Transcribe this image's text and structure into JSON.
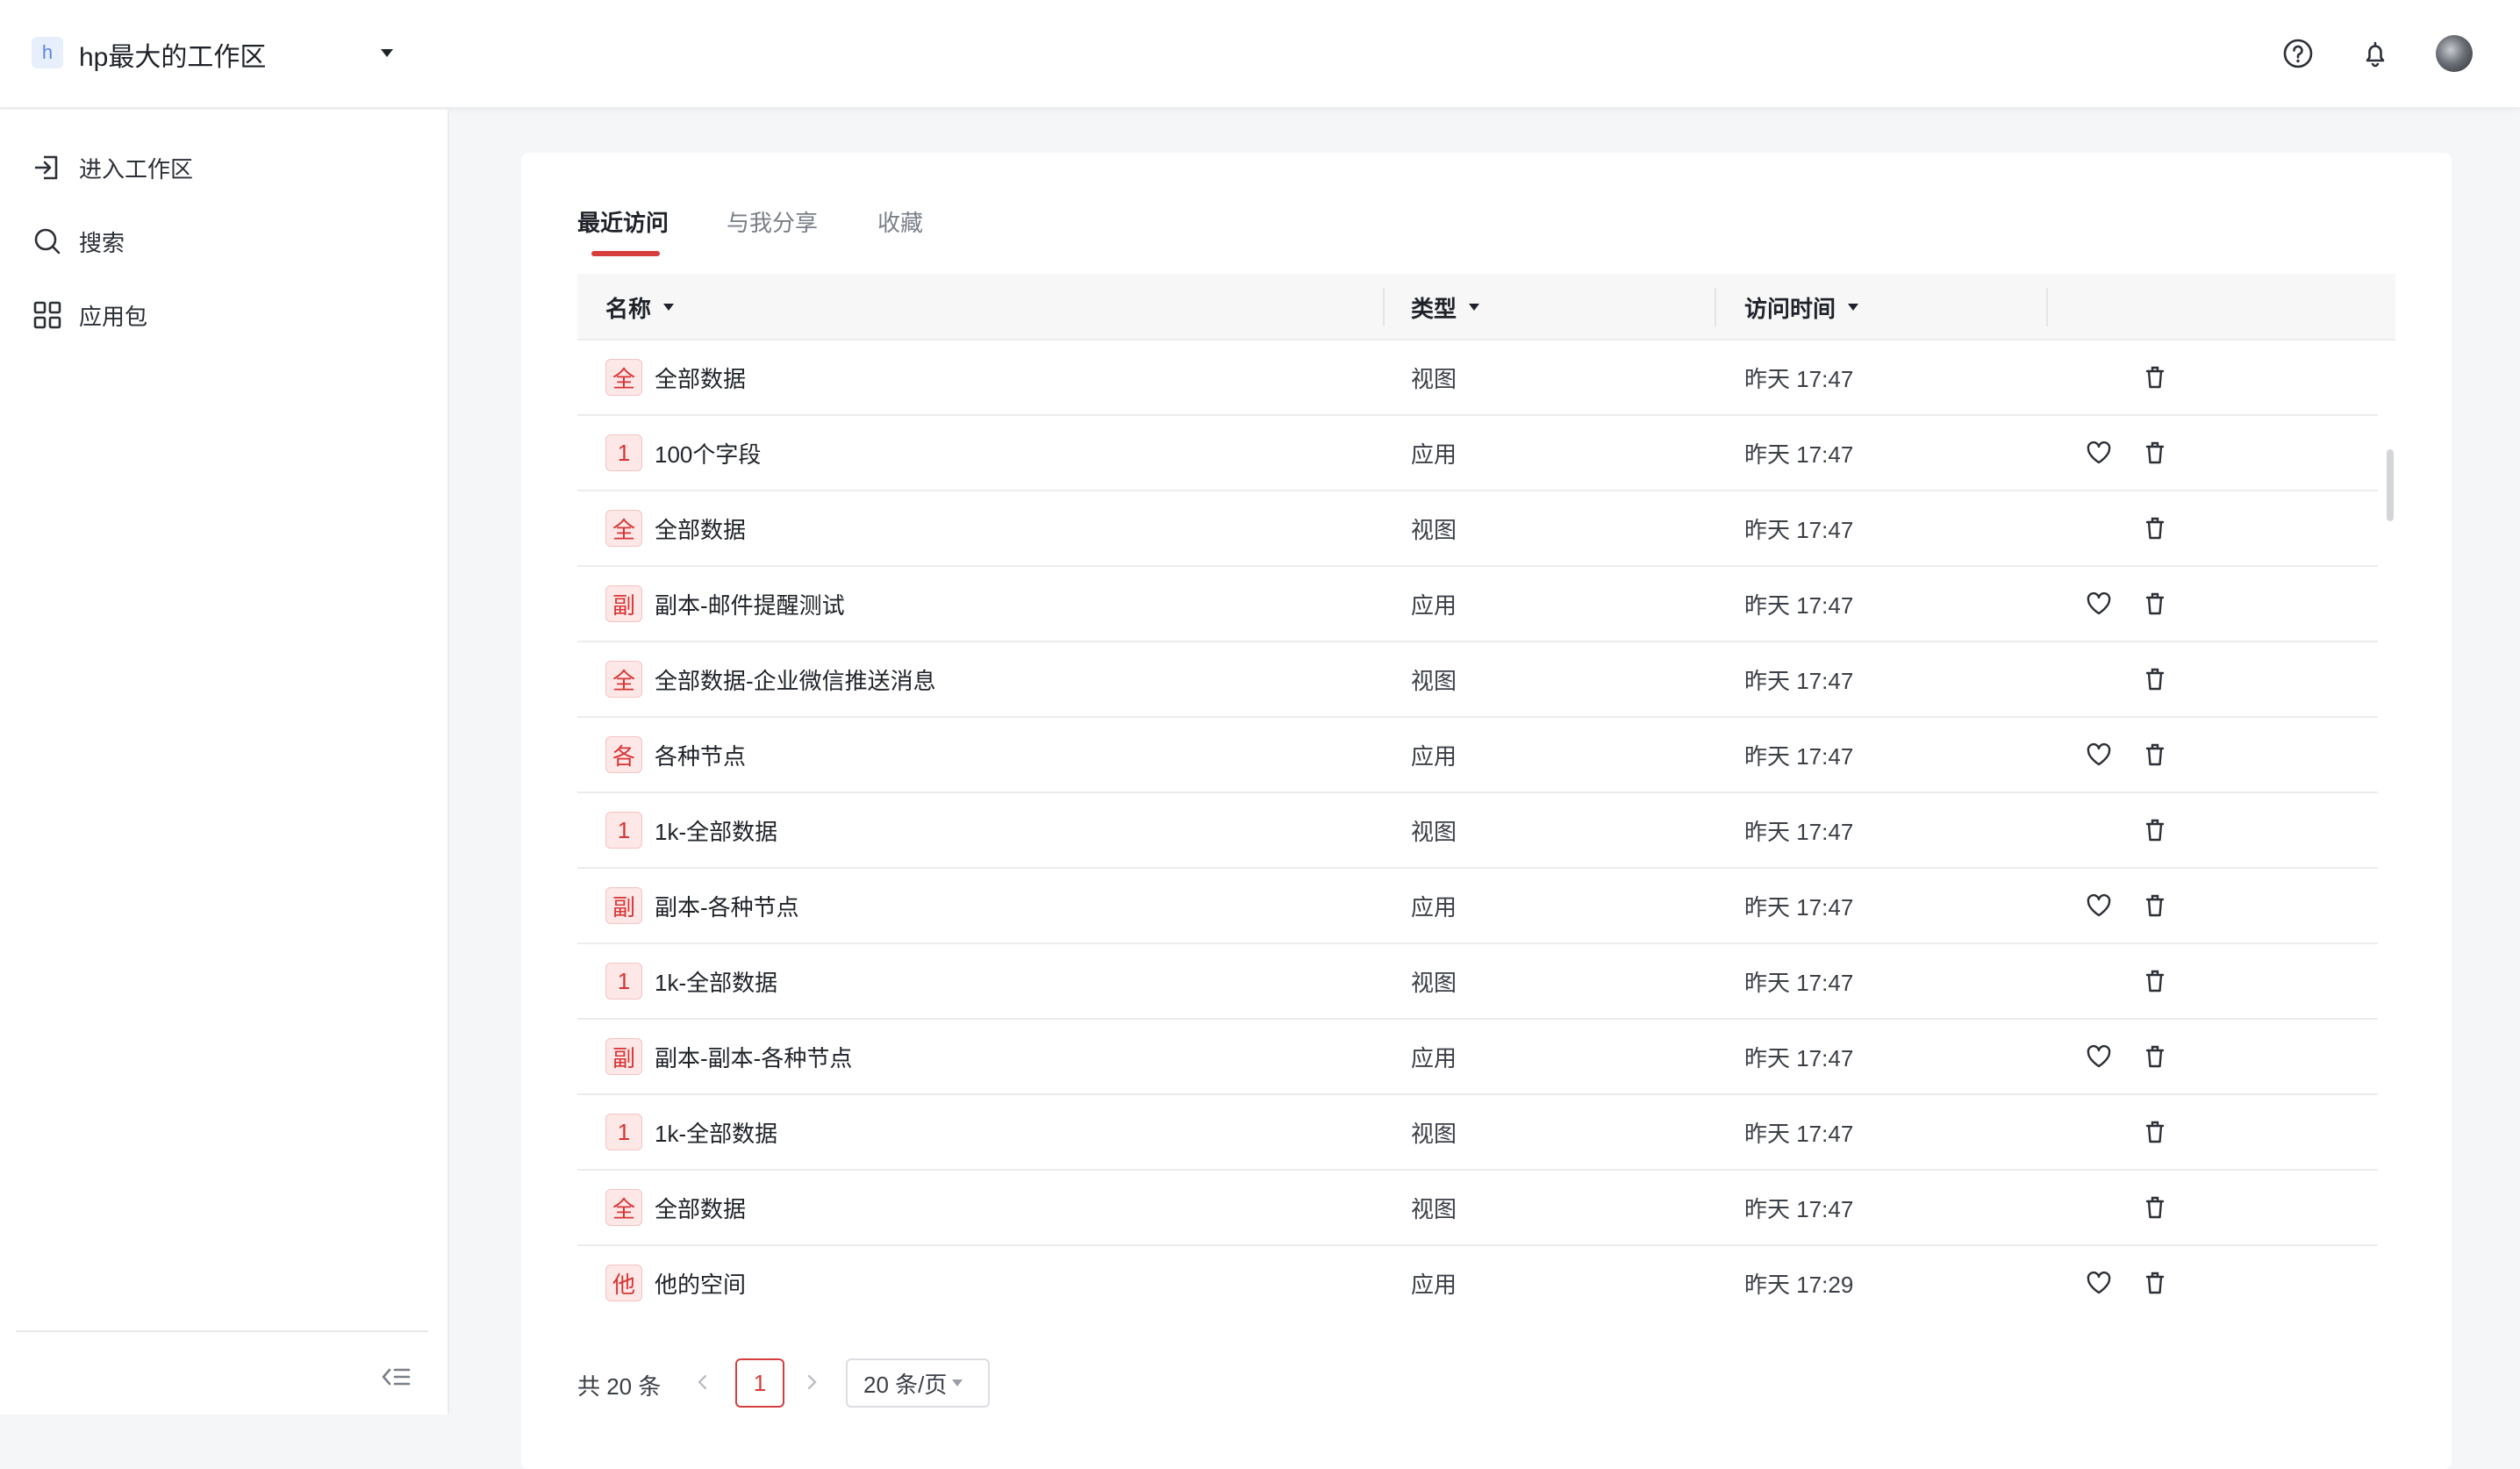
{
  "header": {
    "workspace_initial": "h",
    "workspace_name": "hp最大的工作区",
    "icons": [
      "help-icon",
      "bell-icon",
      "avatar"
    ]
  },
  "sidebar": {
    "items": [
      {
        "label": "进入工作区",
        "icon": "enter-icon"
      },
      {
        "label": "搜索",
        "icon": "search-icon"
      },
      {
        "label": "应用包",
        "icon": "grid-icon"
      }
    ]
  },
  "tabs": [
    {
      "label": "最近访问",
      "active": true
    },
    {
      "label": "与我分享",
      "active": false
    },
    {
      "label": "收藏",
      "active": false
    }
  ],
  "table": {
    "columns": {
      "name": "名称",
      "type": "类型",
      "time": "访问时间"
    },
    "rows": [
      {
        "badge": "全",
        "name": "全部数据",
        "type": "视图",
        "time": "昨天 17:47",
        "favorite": false
      },
      {
        "badge": "1",
        "name": "100个字段",
        "type": "应用",
        "time": "昨天 17:47",
        "favorite": true
      },
      {
        "badge": "全",
        "name": "全部数据",
        "type": "视图",
        "time": "昨天 17:47",
        "favorite": false
      },
      {
        "badge": "副",
        "name": "副本-邮件提醒测试",
        "type": "应用",
        "time": "昨天 17:47",
        "favorite": true
      },
      {
        "badge": "全",
        "name": "全部数据-企业微信推送消息",
        "type": "视图",
        "time": "昨天 17:47",
        "favorite": false
      },
      {
        "badge": "各",
        "name": "各种节点",
        "type": "应用",
        "time": "昨天 17:47",
        "favorite": true
      },
      {
        "badge": "1",
        "name": "1k-全部数据",
        "type": "视图",
        "time": "昨天 17:47",
        "favorite": false
      },
      {
        "badge": "副",
        "name": "副本-各种节点",
        "type": "应用",
        "time": "昨天 17:47",
        "favorite": true
      },
      {
        "badge": "1",
        "name": "1k-全部数据",
        "type": "视图",
        "time": "昨天 17:47",
        "favorite": false
      },
      {
        "badge": "副",
        "name": "副本-副本-各种节点",
        "type": "应用",
        "time": "昨天 17:47",
        "favorite": true
      },
      {
        "badge": "1",
        "name": "1k-全部数据",
        "type": "视图",
        "time": "昨天 17:47",
        "favorite": false
      },
      {
        "badge": "全",
        "name": "全部数据",
        "type": "视图",
        "time": "昨天 17:47",
        "favorite": false
      },
      {
        "badge": "他",
        "name": "他的空间",
        "type": "应用",
        "time": "昨天 17:29",
        "favorite": true
      }
    ]
  },
  "pagination": {
    "total_label": "共 20 条",
    "current_page": "1",
    "page_size_label": "20 条/页"
  },
  "colors": {
    "accent": "#d63e3e",
    "badge_bg": "#fde7e7"
  }
}
